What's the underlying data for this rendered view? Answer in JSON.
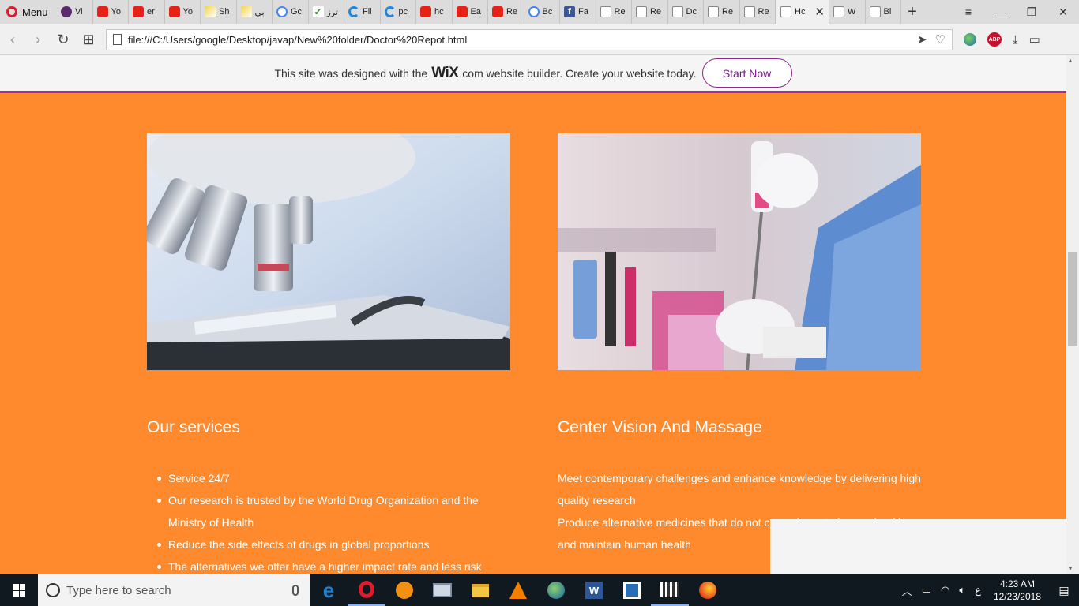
{
  "browser": {
    "menu_label": "Menu",
    "tabs": [
      {
        "label": "Vi",
        "icon": "purple-app-icon"
      },
      {
        "label": "Yo",
        "icon": "youtube-icon"
      },
      {
        "label": "er",
        "icon": "youtube-icon"
      },
      {
        "label": "Yo",
        "icon": "youtube-icon"
      },
      {
        "label": "Sh",
        "icon": "image-icon"
      },
      {
        "label": "بي",
        "icon": "image-icon"
      },
      {
        "label": "Gc",
        "icon": "google-icon"
      },
      {
        "label": "ترز",
        "icon": "checkmark-icon"
      },
      {
        "label": "Fil",
        "icon": "blue-circle-icon"
      },
      {
        "label": "pc",
        "icon": "blue-circle-icon"
      },
      {
        "label": "hc",
        "icon": "youtube-icon"
      },
      {
        "label": "Ea",
        "icon": "youtube-icon"
      },
      {
        "label": "Re",
        "icon": "youtube-icon"
      },
      {
        "label": "Bc",
        "icon": "google-icon"
      },
      {
        "label": "Fa",
        "icon": "facebook-icon"
      },
      {
        "label": "Re",
        "icon": "document-icon"
      },
      {
        "label": "Re",
        "icon": "document-icon"
      },
      {
        "label": "Dc",
        "icon": "document-icon"
      },
      {
        "label": "Re",
        "icon": "document-icon"
      },
      {
        "label": "Re",
        "icon": "document-icon"
      }
    ],
    "active_tab": "Hc",
    "after_tabs": [
      {
        "label": "W",
        "icon": "document-icon"
      },
      {
        "label": "Bl",
        "icon": "document-icon"
      }
    ],
    "url": "file:///C:/Users/google/Desktop/javap/New%20folder/Doctor%20Repot.html"
  },
  "wix_banner": {
    "prefix": "This site was designed with the",
    "logo": "WiX",
    "suffix": ".com website builder. Create your website today.",
    "button": "Start Now"
  },
  "page": {
    "services_title": "Our services",
    "services": [
      "Service 24/7",
      "Our research is trusted by the World Drug Organization and the Ministry of Health",
      "Reduce the side effects of drugs in global proportions",
      "The alternatives we offer have a higher impact rate and less risk"
    ],
    "center_title": "Center Vision And Massage",
    "center_lines": [
      "Meet contemporary challenges and enhance knowledge by delivering high quality research",
      "Produce alternative medicines that do not cause harm to human health and maintain human health"
    ]
  },
  "taskbar": {
    "search_placeholder": "Type here to search",
    "language": "ع",
    "time": "4:23 AM",
    "date": "12/23/2018"
  },
  "colors": {
    "page_bg": "#ff8a2e",
    "wix_accent": "#9b2fae"
  }
}
